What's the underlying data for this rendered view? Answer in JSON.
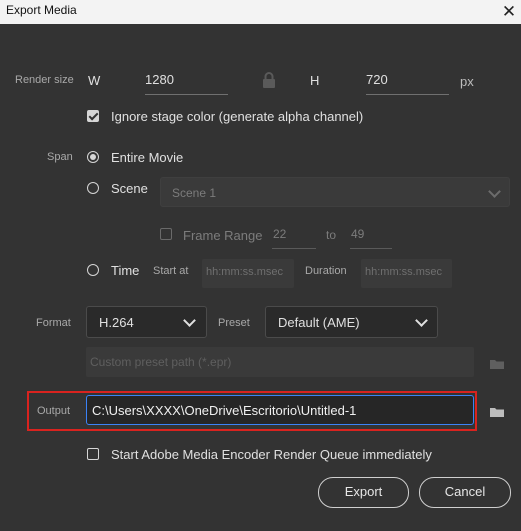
{
  "window": {
    "title": "Export Media",
    "close_glyph": "✕"
  },
  "render_size": {
    "label": "Render size",
    "width_label": "W",
    "width_value": "1280",
    "height_label": "H",
    "height_value": "720",
    "unit": "px",
    "lock_icon": "lock-icon"
  },
  "ignore_stage": {
    "label": "Ignore stage color (generate alpha channel)",
    "checked": true
  },
  "span": {
    "label": "Span",
    "entire_movie": "Entire Movie",
    "scene": "Scene",
    "scene_select_value": "Scene 1",
    "frame_range_label": "Frame Range",
    "frame_from": "22",
    "to_label": "to",
    "frame_to": "49",
    "time": "Time",
    "start_at_label": "Start at",
    "start_placeholder": "hh:mm:ss.msec",
    "duration_label": "Duration",
    "duration_placeholder": "hh:mm:ss.msec",
    "selected": "Entire Movie"
  },
  "format": {
    "label": "Format",
    "value": "H.264",
    "preset_label": "Preset",
    "preset_value": "Default (AME)",
    "custom_preset_placeholder": "Custom preset path (*.epr)"
  },
  "output": {
    "label": "Output",
    "value": "C:\\Users\\XXXX\\OneDrive\\Escritorio\\Untitled-1",
    "highlight_color": "#d9231f",
    "focus_color": "#3b82f6"
  },
  "ame_queue": {
    "label": "Start Adobe Media Encoder Render Queue immediately",
    "checked": false
  },
  "buttons": {
    "export": "Export",
    "cancel": "Cancel"
  }
}
